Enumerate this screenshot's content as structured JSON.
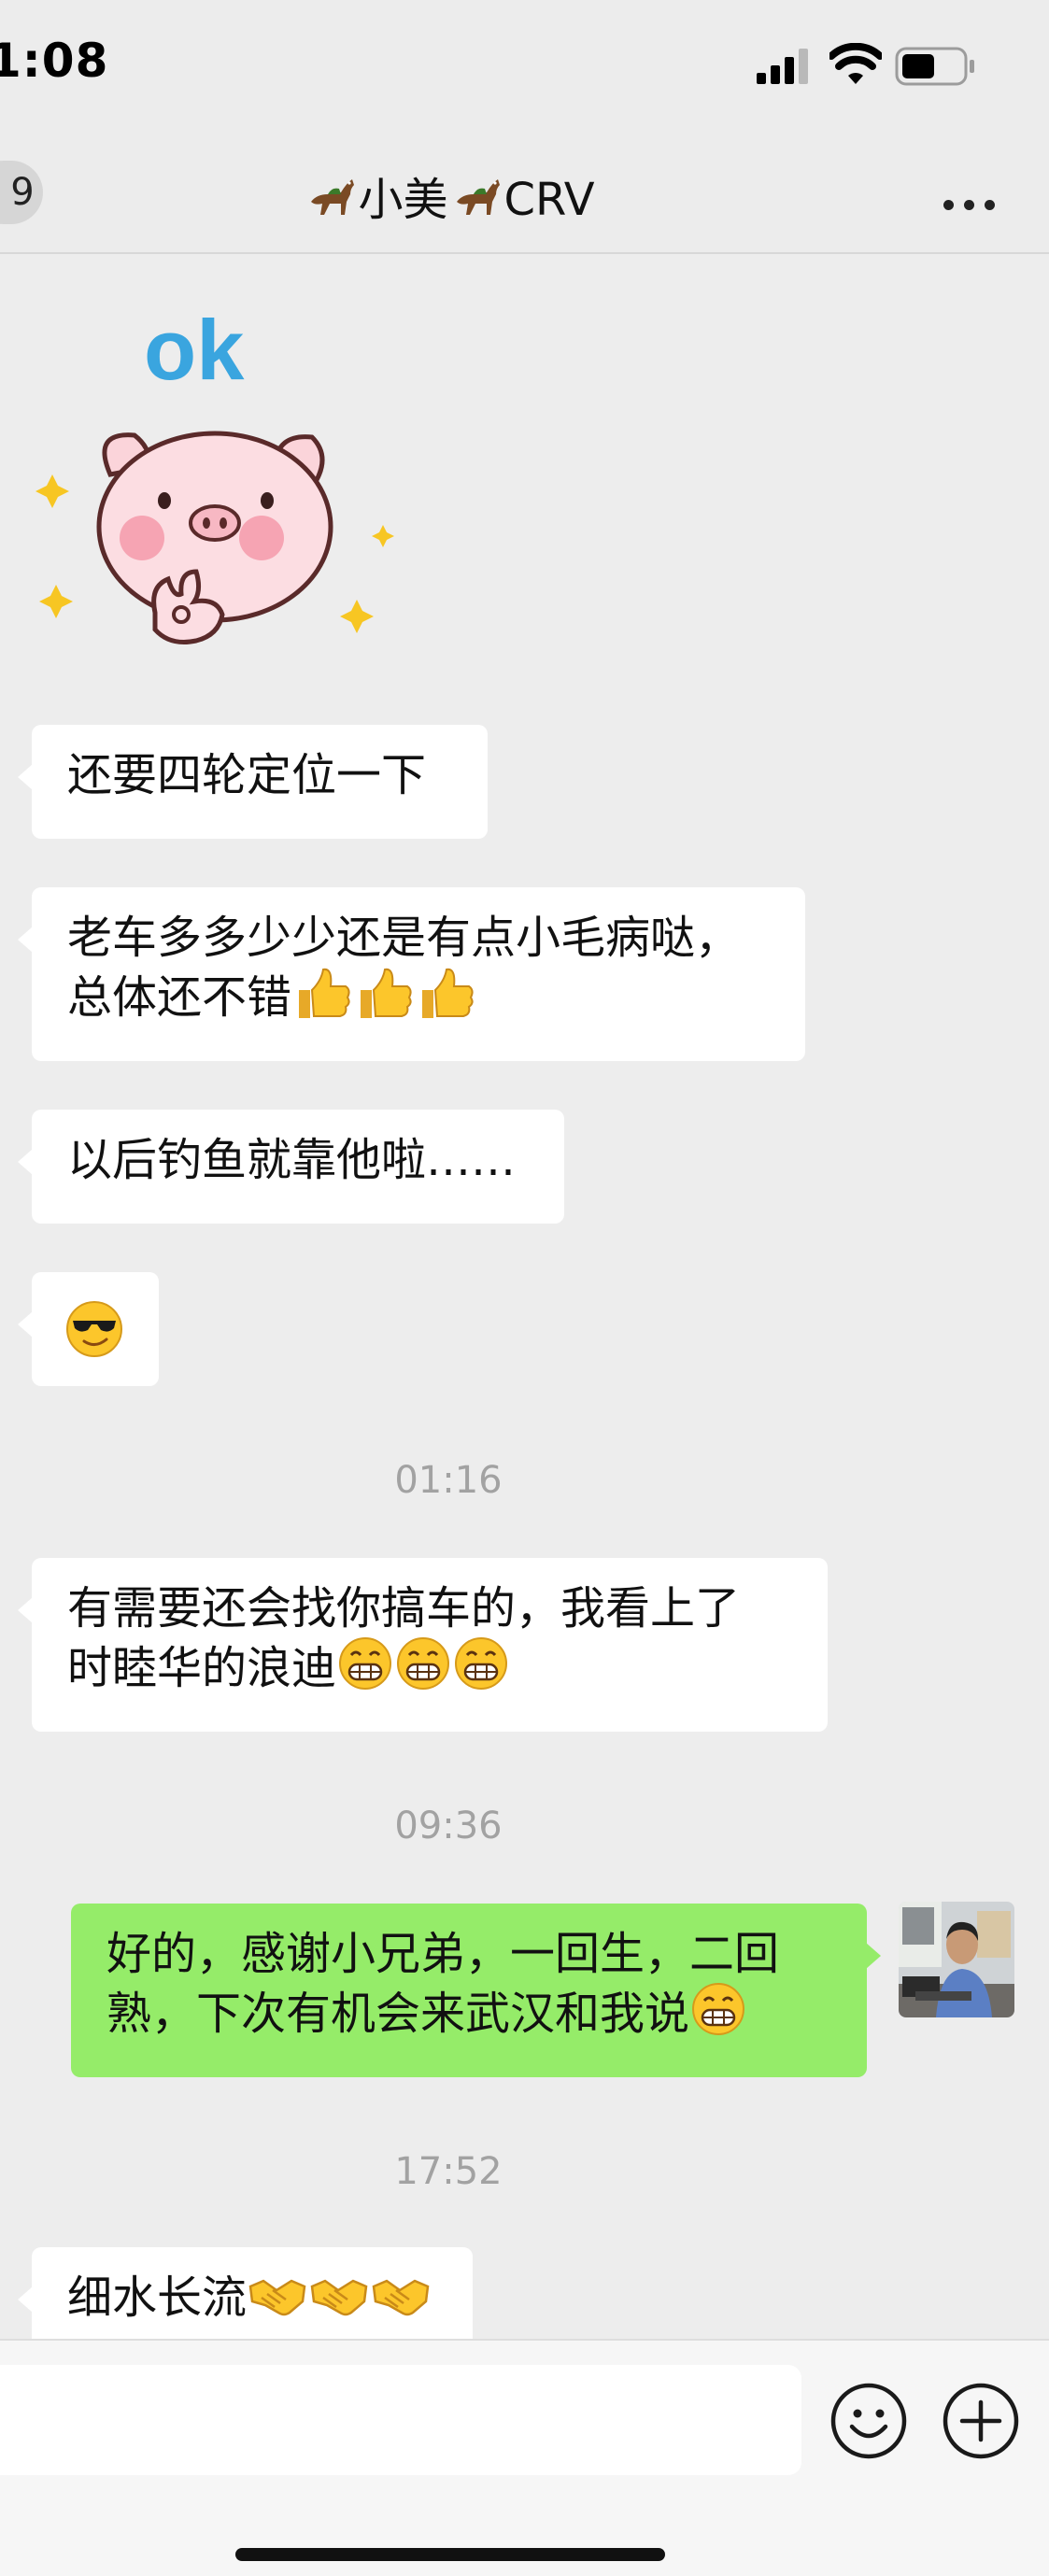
{
  "status_bar": {
    "time": "1:08",
    "battery_level": 0.55
  },
  "nav": {
    "back_count": "9",
    "title_part1": "小美",
    "title_part2": "CRV",
    "title_icon": "horse-emoji"
  },
  "sticker": {
    "text": "ok",
    "description_icon": "pig-ok-sticker"
  },
  "messages": [
    {
      "side": "incoming",
      "lines": [
        "还要四轮定位一下"
      ]
    },
    {
      "side": "incoming",
      "lines": [
        "老车多多少少还是有点小毛病哒，",
        "总体还不错"
      ],
      "emoji": "thumbs-up",
      "emoji_count": 3
    },
    {
      "side": "incoming",
      "lines": [
        "以后钓鱼就靠他啦……"
      ]
    },
    {
      "side": "incoming",
      "lines": [],
      "emoji": "sunglasses",
      "emoji_count": 1
    },
    {
      "side": "incoming",
      "lines": [
        "有需要还会找你搞车的，我看上了",
        "时睦华的浪迪"
      ],
      "emoji": "grin",
      "emoji_count": 3
    },
    {
      "side": "outgoing",
      "lines": [
        "好的，感谢小兄弟，一回生，二回",
        "熟，下次有机会来武汉和我说"
      ],
      "emoji": "grin",
      "emoji_count": 1
    },
    {
      "side": "incoming",
      "lines": [
        "细水长流"
      ],
      "emoji": "handshake",
      "emoji_count": 3
    }
  ],
  "timestamps": [
    "01:16",
    "09:36",
    "17:52"
  ],
  "input": {
    "value": "",
    "placeholder": ""
  },
  "colors": {
    "background": "#ededed",
    "incoming_bubble": "#ffffff",
    "outgoing_bubble": "#95ec69",
    "timestamp": "#a2a2a2"
  }
}
